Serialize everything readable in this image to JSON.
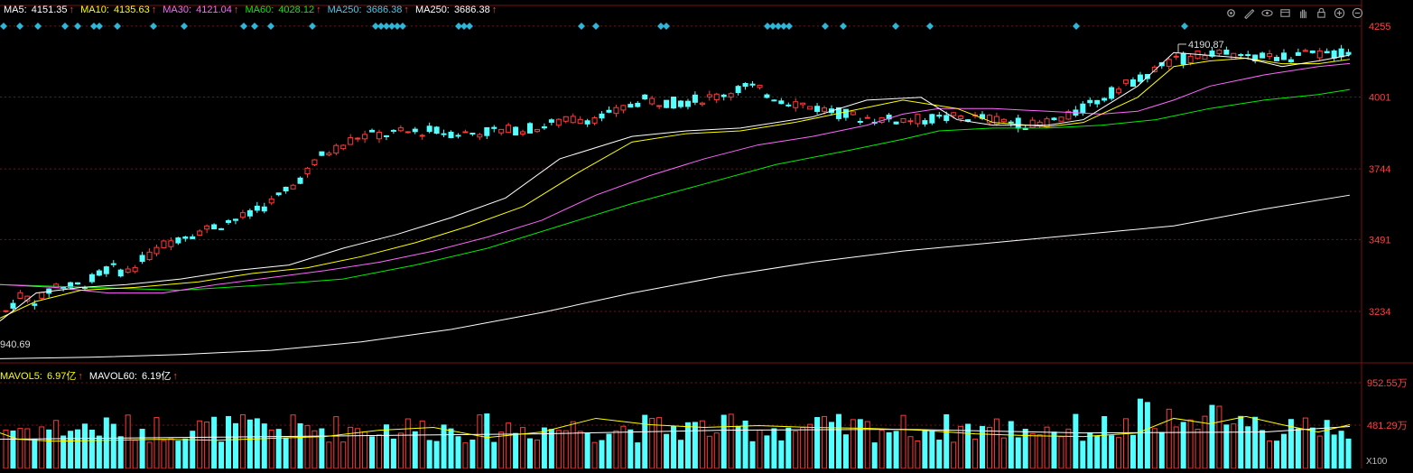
{
  "legend_price": {
    "ma5": {
      "label": "MA5:",
      "value": "4151.35",
      "arrow": "↑",
      "color": "#ffffff"
    },
    "ma10": {
      "label": "MA10:",
      "value": "4135.63",
      "arrow": "↑",
      "color": "#ffff00"
    },
    "ma30": {
      "label": "MA30:",
      "value": "4121.04",
      "arrow": "↑",
      "color": "#ff66ff"
    },
    "ma60": {
      "label": "MA60:",
      "value": "4028.12",
      "arrow": "↑",
      "color": "#00ee00"
    },
    "ma250a": {
      "label": "MA250:",
      "value": "3686.38",
      "arrow": "↑",
      "color": "#44ccee"
    },
    "ma250b": {
      "label": "MA250:",
      "value": "3686.38",
      "arrow": "↑",
      "color": "#ffffff"
    }
  },
  "legend_volume": {
    "mavol5": {
      "label": "MAVOL5:",
      "value": "6.97亿",
      "arrow": "↑",
      "color": "#ffff00"
    },
    "mavol60": {
      "label": "MAVOL60:",
      "value": "6.19亿",
      "arrow": "↑",
      "color": "#ffffff"
    }
  },
  "toolbar": {
    "icons": [
      "settings-icon",
      "draw-pen-icon",
      "eye-icon",
      "indicator-icon",
      "hand-icon",
      "lock-icon",
      "zoom-in-icon",
      "zoom-out-icon"
    ]
  },
  "annotations": {
    "high_label": "4190.87",
    "low_label": "940.69",
    "volume_unit": "X100"
  },
  "colors": {
    "up": "#ff3b3b",
    "down": "#54ffff",
    "grid": "#7a1010",
    "axis_text": "#ff4040",
    "ma5": "#ffffff",
    "ma10": "#ffff00",
    "ma30": "#ff66ff",
    "ma60": "#00ee00",
    "ma250": "#ffffff"
  },
  "chart_data": {
    "type": "candlestick",
    "price_axis": {
      "ticks": [
        "4255",
        "4001",
        "3744",
        "3491",
        "3234"
      ],
      "ylim": [
        3050,
        4290
      ]
    },
    "volume_axis": {
      "ticks": [
        "952.55万",
        "481.29万"
      ],
      "ylim": [
        0,
        1000
      ]
    },
    "candles": {
      "count": 146,
      "anchors": [
        [
          0,
          3220
        ],
        [
          10,
          3290
        ],
        [
          20,
          3270
        ],
        [
          30,
          3330
        ],
        [
          40,
          3320
        ],
        [
          50,
          3345
        ],
        [
          60,
          3390
        ],
        [
          70,
          3375
        ],
        [
          80,
          3420
        ],
        [
          90,
          3470
        ],
        [
          100,
          3500
        ],
        [
          110,
          3520
        ],
        [
          120,
          3540
        ],
        [
          130,
          3560
        ],
        [
          140,
          3580
        ],
        [
          150,
          3620
        ],
        [
          160,
          3660
        ],
        [
          180,
          3790
        ],
        [
          200,
          3860
        ],
        [
          220,
          3870
        ],
        [
          240,
          3880
        ],
        [
          260,
          3870
        ],
        [
          280,
          3880
        ],
        [
          300,
          3890
        ],
        [
          320,
          3920
        ],
        [
          340,
          3930
        ],
        [
          360,
          3990
        ],
        [
          380,
          3980
        ],
        [
          400,
          4000
        ],
        [
          420,
          4040
        ],
        [
          440,
          3990
        ],
        [
          460,
          3960
        ],
        [
          480,
          3930
        ],
        [
          500,
          3920
        ],
        [
          520,
          3920
        ],
        [
          540,
          3930
        ],
        [
          560,
          3920
        ],
        [
          580,
          3900
        ],
        [
          600,
          3930
        ],
        [
          620,
          4000
        ],
        [
          640,
          4070
        ],
        [
          660,
          4130
        ],
        [
          680,
          4160
        ],
        [
          700,
          4140
        ],
        [
          720,
          4145
        ],
        [
          740,
          4150
        ],
        [
          760,
          4160
        ]
      ]
    },
    "ma_series": {
      "ma5": [
        [
          0,
          3200
        ],
        [
          40,
          3300
        ],
        [
          90,
          3320
        ],
        [
          140,
          3330
        ],
        [
          200,
          3350
        ],
        [
          260,
          3380
        ],
        [
          320,
          3400
        ],
        [
          380,
          3460
        ],
        [
          440,
          3510
        ],
        [
          500,
          3570
        ],
        [
          560,
          3640
        ],
        [
          620,
          3780
        ],
        [
          700,
          3860
        ],
        [
          760,
          3880
        ],
        [
          820,
          3890
        ],
        [
          900,
          3930
        ],
        [
          960,
          3990
        ],
        [
          1020,
          4000
        ],
        [
          1060,
          3920
        ],
        [
          1100,
          3900
        ],
        [
          1160,
          3900
        ],
        [
          1200,
          3920
        ],
        [
          1260,
          4040
        ],
        [
          1300,
          4160
        ],
        [
          1340,
          4150
        ],
        [
          1380,
          4140
        ],
        [
          1420,
          4110
        ],
        [
          1460,
          4130
        ],
        [
          1495,
          4151
        ]
      ],
      "ma10": [
        [
          0,
          3210
        ],
        [
          40,
          3270
        ],
        [
          90,
          3310
        ],
        [
          150,
          3320
        ],
        [
          220,
          3340
        ],
        [
          280,
          3370
        ],
        [
          340,
          3390
        ],
        [
          400,
          3430
        ],
        [
          460,
          3480
        ],
        [
          520,
          3540
        ],
        [
          580,
          3610
        ],
        [
          640,
          3730
        ],
        [
          700,
          3840
        ],
        [
          760,
          3870
        ],
        [
          820,
          3880
        ],
        [
          880,
          3910
        ],
        [
          940,
          3950
        ],
        [
          1000,
          3990
        ],
        [
          1060,
          3960
        ],
        [
          1100,
          3910
        ],
        [
          1160,
          3895
        ],
        [
          1200,
          3910
        ],
        [
          1260,
          4000
        ],
        [
          1300,
          4110
        ],
        [
          1340,
          4130
        ],
        [
          1380,
          4140
        ],
        [
          1420,
          4120
        ],
        [
          1460,
          4120
        ],
        [
          1495,
          4136
        ]
      ],
      "ma30": [
        [
          0,
          3330
        ],
        [
          60,
          3320
        ],
        [
          120,
          3300
        ],
        [
          180,
          3300
        ],
        [
          240,
          3330
        ],
        [
          300,
          3355
        ],
        [
          360,
          3380
        ],
        [
          420,
          3410
        ],
        [
          480,
          3450
        ],
        [
          540,
          3500
        ],
        [
          600,
          3560
        ],
        [
          660,
          3650
        ],
        [
          720,
          3720
        ],
        [
          780,
          3780
        ],
        [
          840,
          3830
        ],
        [
          900,
          3860
        ],
        [
          960,
          3900
        ],
        [
          1000,
          3940
        ],
        [
          1040,
          3960
        ],
        [
          1100,
          3960
        ],
        [
          1160,
          3950
        ],
        [
          1220,
          3940
        ],
        [
          1260,
          3950
        ],
        [
          1300,
          3990
        ],
        [
          1340,
          4040
        ],
        [
          1400,
          4080
        ],
        [
          1460,
          4110
        ],
        [
          1495,
          4121
        ]
      ],
      "ma60": [
        [
          0,
          3330
        ],
        [
          100,
          3320
        ],
        [
          200,
          3310
        ],
        [
          300,
          3330
        ],
        [
          380,
          3350
        ],
        [
          460,
          3400
        ],
        [
          540,
          3460
        ],
        [
          620,
          3540
        ],
        [
          700,
          3620
        ],
        [
          780,
          3690
        ],
        [
          860,
          3760
        ],
        [
          940,
          3810
        ],
        [
          1000,
          3850
        ],
        [
          1040,
          3880
        ],
        [
          1100,
          3890
        ],
        [
          1160,
          3890
        ],
        [
          1220,
          3900
        ],
        [
          1280,
          3920
        ],
        [
          1340,
          3960
        ],
        [
          1400,
          3990
        ],
        [
          1460,
          4010
        ],
        [
          1495,
          4028
        ]
      ],
      "ma250": [
        [
          0,
          3065
        ],
        [
          100,
          3070
        ],
        [
          200,
          3080
        ],
        [
          300,
          3095
        ],
        [
          400,
          3125
        ],
        [
          500,
          3170
        ],
        [
          600,
          3230
        ],
        [
          700,
          3300
        ],
        [
          800,
          3360
        ],
        [
          900,
          3410
        ],
        [
          1000,
          3450
        ],
        [
          1100,
          3480
        ],
        [
          1200,
          3510
        ],
        [
          1300,
          3540
        ],
        [
          1400,
          3600
        ],
        [
          1495,
          3650
        ]
      ]
    },
    "volume": {
      "mavol5": [
        [
          0,
          0.39
        ],
        [
          20,
          0.32
        ],
        [
          60,
          0.3
        ],
        [
          120,
          0.31
        ],
        [
          180,
          0.32
        ],
        [
          240,
          0.31
        ],
        [
          300,
          0.33
        ],
        [
          360,
          0.35
        ],
        [
          420,
          0.42
        ],
        [
          480,
          0.45
        ],
        [
          540,
          0.34
        ],
        [
          600,
          0.4
        ],
        [
          660,
          0.55
        ],
        [
          720,
          0.48
        ],
        [
          780,
          0.45
        ],
        [
          840,
          0.47
        ],
        [
          900,
          0.45
        ],
        [
          960,
          0.44
        ],
        [
          1020,
          0.42
        ],
        [
          1080,
          0.38
        ],
        [
          1140,
          0.36
        ],
        [
          1200,
          0.35
        ],
        [
          1260,
          0.39
        ],
        [
          1300,
          0.55
        ],
        [
          1340,
          0.49
        ],
        [
          1380,
          0.57
        ],
        [
          1420,
          0.48
        ],
        [
          1460,
          0.4
        ],
        [
          1495,
          0.48
        ]
      ],
      "mavol60": [
        [
          0,
          0.32
        ],
        [
          200,
          0.34
        ],
        [
          400,
          0.36
        ],
        [
          600,
          0.38
        ],
        [
          800,
          0.42
        ],
        [
          1000,
          0.43
        ],
        [
          1200,
          0.39
        ],
        [
          1400,
          0.4
        ],
        [
          1495,
          0.46
        ]
      ]
    }
  }
}
